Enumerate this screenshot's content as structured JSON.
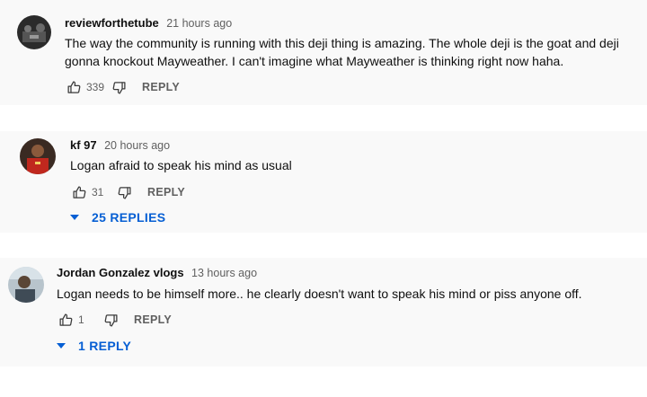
{
  "comments": [
    {
      "author": "reviewforthetube",
      "time": "21 hours ago",
      "text": "The way the community is running with this deji thing is amazing. The whole deji is the goat and deji gonna knockout Mayweather. I can't imagine what Mayweather is thinking right now haha.",
      "likes": "339",
      "reply_label": "REPLY"
    },
    {
      "author": "kf 97",
      "time": "20 hours ago",
      "text": "Logan afraid to speak his mind as usual",
      "likes": "31",
      "reply_label": "REPLY",
      "replies_label": "25 REPLIES"
    },
    {
      "author": "Jordan Gonzalez vlogs",
      "time": "13 hours ago",
      "text": "Logan needs to be himself more.. he clearly doesn't want to speak his mind or piss anyone off.",
      "likes": "1",
      "reply_label": "REPLY",
      "replies_label": "1 REPLY"
    }
  ],
  "colors": {
    "card_bg": "#f9f9f9",
    "link_blue": "#065fd4",
    "secondary_text": "#606060"
  },
  "icons": [
    "thumb-up-icon",
    "thumb-down-icon",
    "caret-down-icon"
  ]
}
